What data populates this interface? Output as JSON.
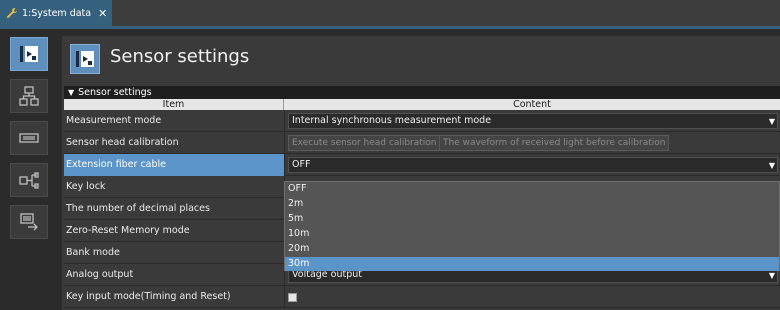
{
  "tab": {
    "label": "1:System data",
    "close": "✕"
  },
  "sidebar": {
    "items": [
      {
        "name": "sensor-settings",
        "active": true
      },
      {
        "name": "hierarchy",
        "active": false
      },
      {
        "name": "device",
        "active": false
      },
      {
        "name": "io-map",
        "active": false
      },
      {
        "name": "transfer",
        "active": false
      }
    ]
  },
  "header": {
    "title": "Sensor settings"
  },
  "section": {
    "label": "Sensor settings",
    "toggle": "▼"
  },
  "table": {
    "col_item": "Item",
    "col_content": "Content",
    "rows": [
      {
        "item": "Measurement mode",
        "value": "Internal synchronous measurement mode"
      },
      {
        "item": "Sensor head calibration",
        "buttons": [
          "Execute sensor head calibration",
          "The waveform of received light before calibration"
        ]
      },
      {
        "item": "Extension fiber cable",
        "value": "OFF"
      },
      {
        "item": "Key lock"
      },
      {
        "item": "The number of decimal places"
      },
      {
        "item": "Zero-Reset Memory mode"
      },
      {
        "item": "Bank mode"
      },
      {
        "item": "Analog output",
        "value": "Voltage output"
      },
      {
        "item": "Key input mode(Timing and Reset)",
        "checked": false
      }
    ]
  },
  "dropdown": {
    "options": [
      "OFF",
      "2m",
      "5m",
      "10m",
      "20m",
      "30m"
    ],
    "highlighted": "30m"
  },
  "arrow_glyph": "▼",
  "colors": {
    "accent": "#5b94c9",
    "tab": "#35617f"
  }
}
